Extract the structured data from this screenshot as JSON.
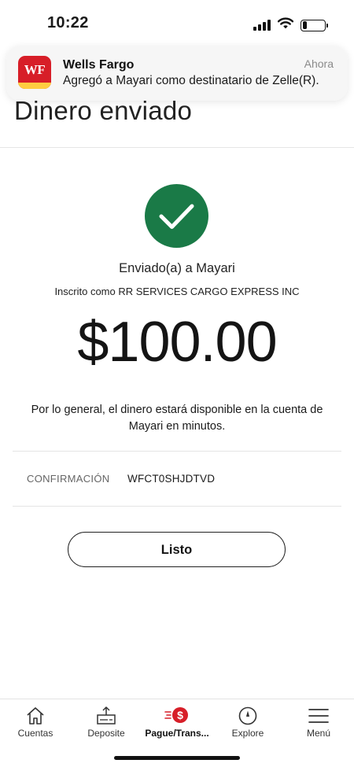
{
  "status_bar": {
    "time": "10:22",
    "icons": [
      "signal-icon",
      "wifi-icon",
      "battery-icon"
    ],
    "battery_level": 0.2
  },
  "header": {
    "title": "Dinero enviado"
  },
  "notification": {
    "app_name": "Wells Fargo",
    "time": "Ahora",
    "message": "Agregó a Mayari como destinatario de Zelle(R).",
    "logo_text": "WF",
    "logo_colors": {
      "primary": "#d71e28",
      "stripe": "#ffcd41"
    }
  },
  "confirmation": {
    "status_icon": "checkmark-circle-icon",
    "status_color": "#1a7a47",
    "sent_to": "Enviado(a) a Mayari",
    "registered_as": "Inscrito como RR SERVICES CARGO EXPRESS INC",
    "amount": "$100.00",
    "availability_note": "Por lo general, el dinero estará disponible en la cuenta de Mayari en minutos.",
    "confirmation_label": "CONFIRMACIÓN",
    "confirmation_code": "WFCT0SHJDTVD"
  },
  "actions": {
    "done_label": "Listo"
  },
  "bottom_nav": {
    "items": [
      {
        "label": "Cuentas",
        "icon": "home-icon",
        "active": false
      },
      {
        "label": "Deposite",
        "icon": "deposit-check-icon",
        "active": false
      },
      {
        "label": "Pague/Trans...",
        "icon": "pay-transfer-icon",
        "active": true
      },
      {
        "label": "Explore",
        "icon": "compass-icon",
        "active": false
      },
      {
        "label": "Menú",
        "icon": "hamburger-menu-icon",
        "active": false
      }
    ],
    "accent_color": "#d71e28"
  }
}
